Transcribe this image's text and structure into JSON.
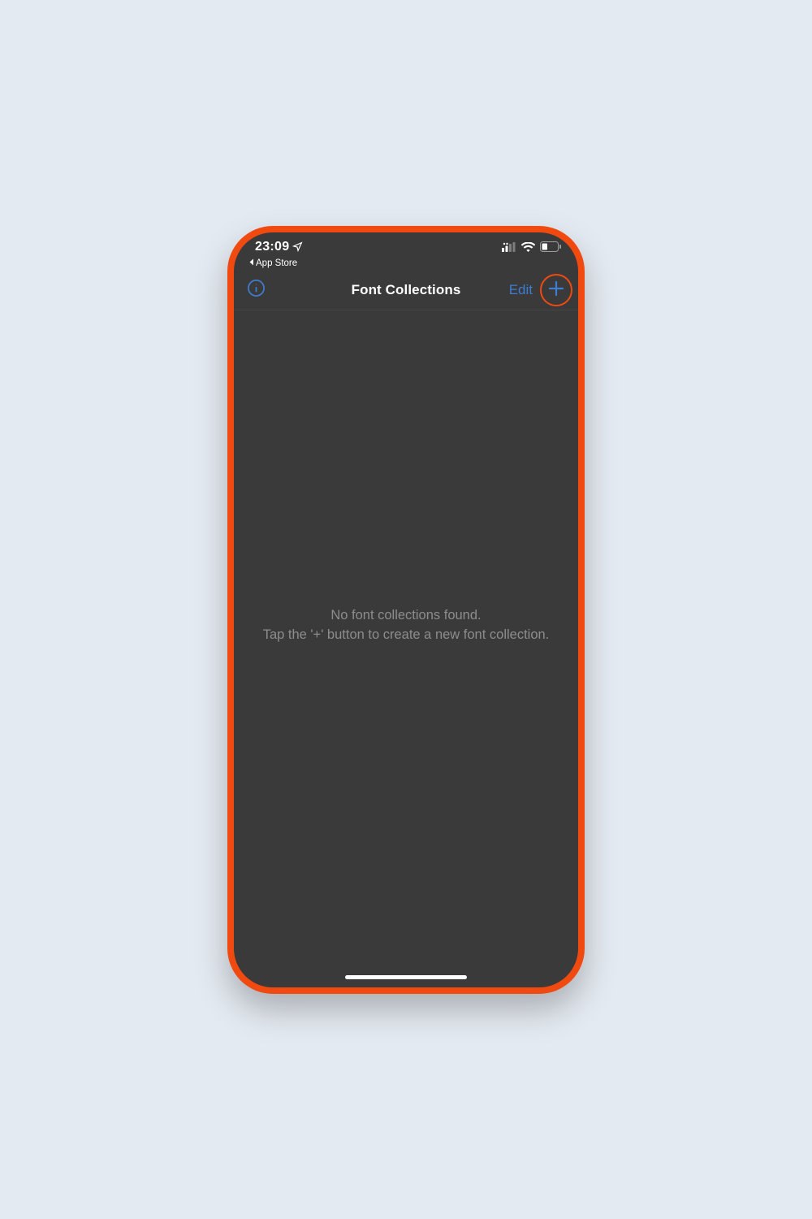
{
  "status": {
    "time": "23:09",
    "back_label": "App Store"
  },
  "nav": {
    "title": "Font Collections",
    "edit_label": "Edit"
  },
  "empty": {
    "line1": "No font collections found.",
    "line2": "Tap the '+' button to create a new font collection."
  },
  "colors": {
    "accent": "#3d7ed0",
    "highlight": "#f04a11",
    "screen_bg": "#3a3a3a"
  }
}
